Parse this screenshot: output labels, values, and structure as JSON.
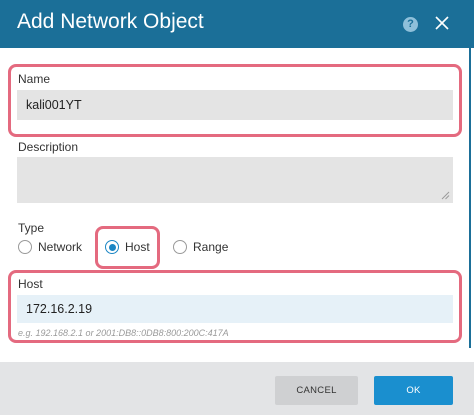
{
  "dialog": {
    "title": "Add Network Object",
    "help_icon": "?"
  },
  "form": {
    "name": {
      "label": "Name",
      "value": "kali001YT"
    },
    "description": {
      "label": "Description",
      "value": ""
    },
    "type": {
      "label": "Type",
      "options": [
        {
          "label": "Network",
          "checked": false
        },
        {
          "label": "Host",
          "checked": true
        },
        {
          "label": "Range",
          "checked": false
        }
      ]
    },
    "host": {
      "label": "Host",
      "value": "172.16.2.19",
      "hint": "e.g. 192.168.2.1 or 2001:DB8::0DB8:800:200C:417A"
    }
  },
  "footer": {
    "cancel_label": "CANCEL",
    "ok_label": "OK"
  },
  "colors": {
    "header": "#1b6f98",
    "highlight": "#e46a7f",
    "primary_button": "#1a8fcf",
    "radio_accent": "#1b86c4"
  }
}
